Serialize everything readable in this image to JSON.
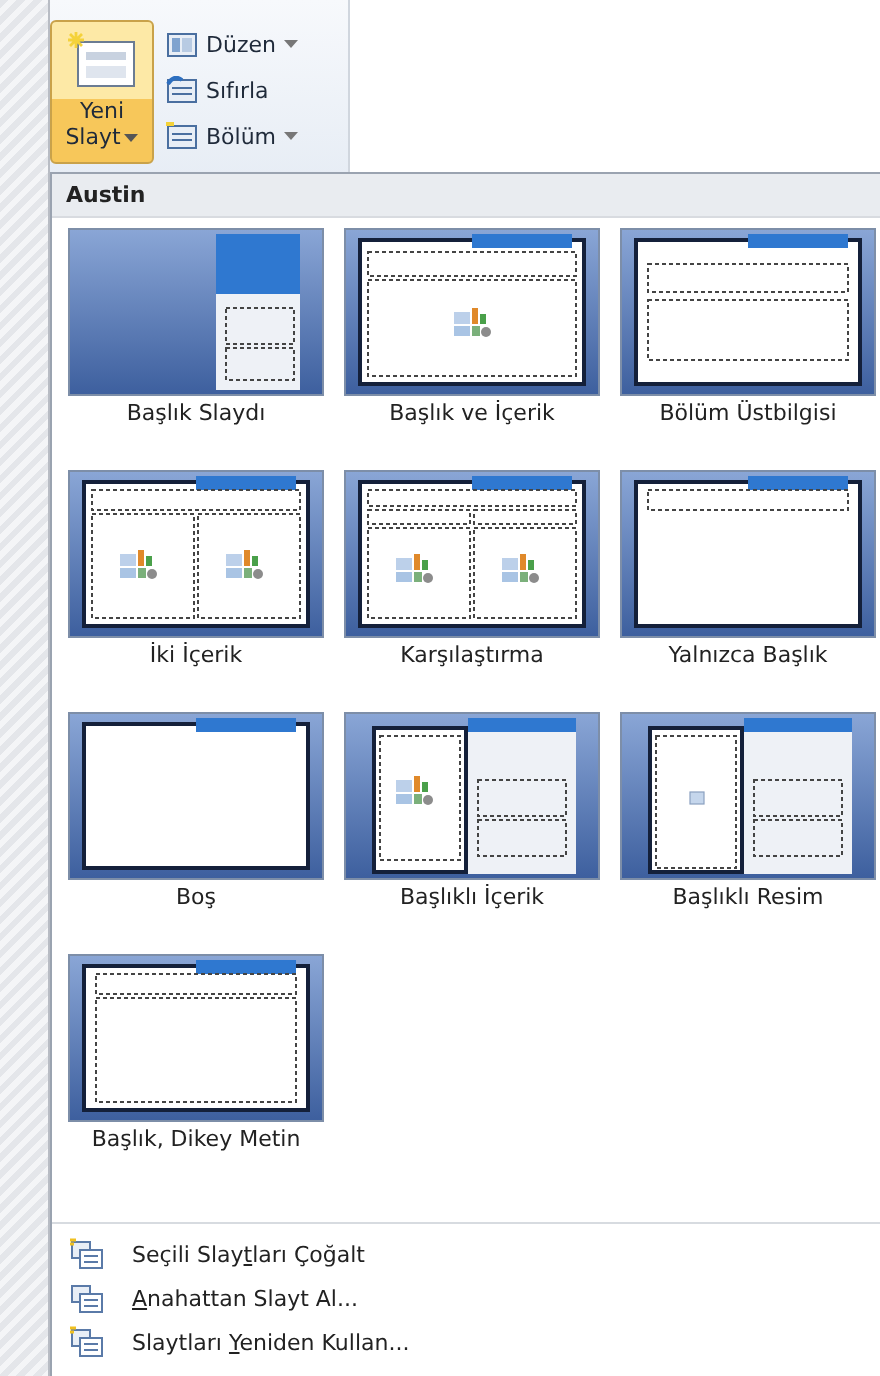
{
  "ribbon": {
    "new_slide": {
      "label_lines": [
        "Yeni",
        "Slayt"
      ],
      "pressed": true,
      "dropdown": true
    },
    "small_buttons": [
      {
        "kind": "layout",
        "label": "Düzen",
        "dropdown": true
      },
      {
        "kind": "reset",
        "label": "Sıfırla",
        "dropdown": false
      },
      {
        "kind": "section",
        "label": "Bölüm",
        "dropdown": true
      }
    ]
  },
  "gallery": {
    "theme": "Austin",
    "layouts": [
      {
        "kind": "title",
        "label": "Başlık Slaydı",
        "selected": false
      },
      {
        "kind": "title-content",
        "label": "Başlık ve İçerik",
        "selected": false
      },
      {
        "kind": "section-header",
        "label": "Bölüm Üstbilgisi",
        "selected": false
      },
      {
        "kind": "two-content",
        "label": "İki İçerik",
        "selected": false
      },
      {
        "kind": "comparison",
        "label": "Karşılaştırma",
        "selected": false
      },
      {
        "kind": "title-only",
        "label": "Yalnızca Başlık",
        "selected": false
      },
      {
        "kind": "blank",
        "label": "Boş",
        "selected": false
      },
      {
        "kind": "content-caption",
        "label": "Başlıklı İçerik",
        "selected": false
      },
      {
        "kind": "picture-caption",
        "label": "Başlıklı Resim",
        "selected": false
      },
      {
        "kind": "vertical-text",
        "label": "Başlık, Dikey Metin",
        "selected": false
      }
    ]
  },
  "menu": [
    {
      "kind": "duplicate",
      "before": "Seçili Slay",
      "key": "t",
      "after": "ları Çoğalt"
    },
    {
      "kind": "outline",
      "key": "A",
      "after": "nahattan Slayt Al..."
    },
    {
      "kind": "reuse",
      "before": "Slaytları ",
      "key": "Y",
      "after": "eniden Kullan..."
    }
  ]
}
